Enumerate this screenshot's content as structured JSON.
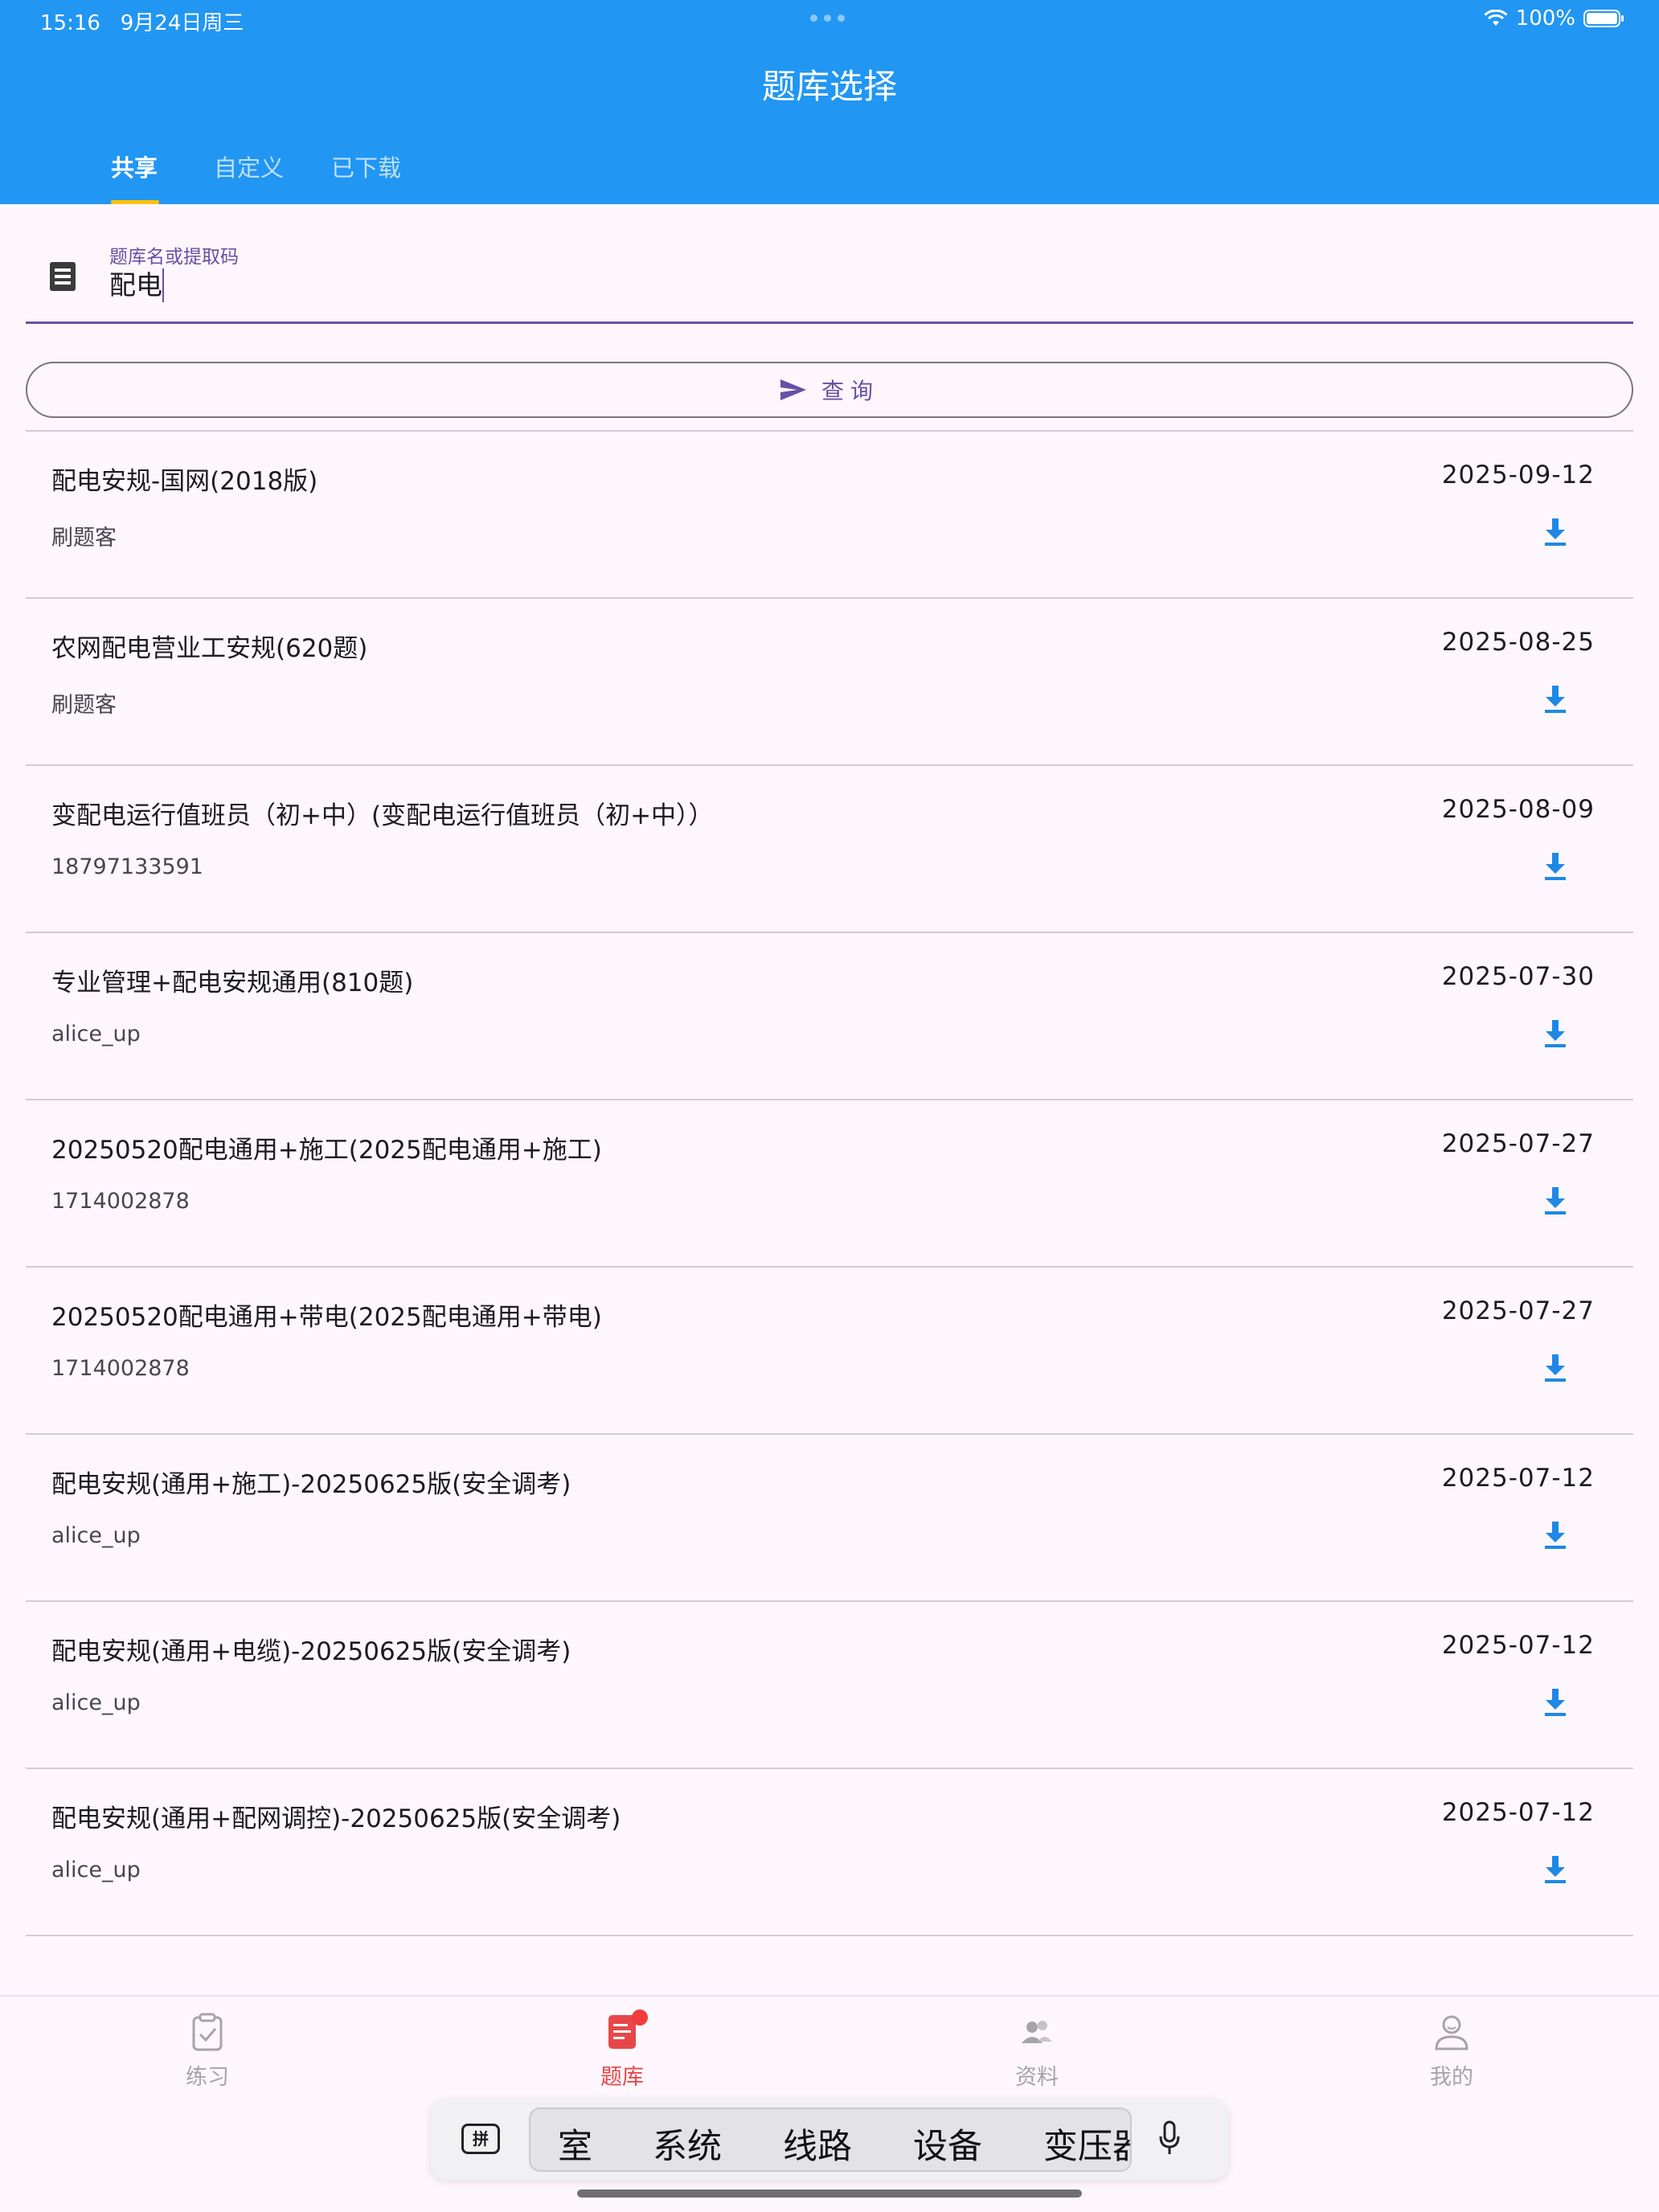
{
  "status_bar": {
    "time": "15:16",
    "date": "9月24日周三",
    "battery": "100%"
  },
  "header": {
    "title": "题库选择"
  },
  "tabs": [
    {
      "label": "共享",
      "active": true
    },
    {
      "label": "自定义",
      "active": false
    },
    {
      "label": "已下载",
      "active": false
    }
  ],
  "search": {
    "label": "题库名或提取码",
    "value": "配电",
    "icon": "list-icon"
  },
  "query_button": {
    "label": "查询",
    "icon": "send-icon"
  },
  "items": [
    {
      "title": "配电安规-国网(2018版)",
      "author": "刷题客",
      "date": "2025-09-12"
    },
    {
      "title": "农网配电营业工安规(620题)",
      "author": "刷题客",
      "date": "2025-08-25"
    },
    {
      "title": "变配电运行值班员（初+中）(变配电运行值班员（初+中））",
      "author": "18797133591",
      "date": "2025-08-09"
    },
    {
      "title": "专业管理+配电安规通用(810题)",
      "author": "alice_up",
      "date": "2025-07-30"
    },
    {
      "title": "20250520配电通用+施工(2025配电通用+施工)",
      "author": "1714002878",
      "date": "2025-07-27"
    },
    {
      "title": "20250520配电通用+带电(2025配电通用+带电)",
      "author": "1714002878",
      "date": "2025-07-27"
    },
    {
      "title": "配电安规(通用+施工)-20250625版(安全调考)",
      "author": "alice_up",
      "date": "2025-07-12"
    },
    {
      "title": "配电安规(通用+电缆)-20250625版(安全调考)",
      "author": "alice_up",
      "date": "2025-07-12"
    },
    {
      "title": "配电安规(通用+配网调控)-20250625版(安全调考)",
      "author": "alice_up",
      "date": "2025-07-12"
    }
  ],
  "bottom_nav": [
    {
      "label": "练习",
      "icon": "clipboard-check-icon",
      "active": false
    },
    {
      "label": "题库",
      "icon": "document-icon",
      "active": true
    },
    {
      "label": "资料",
      "icon": "people-icon",
      "active": false
    },
    {
      "label": "我的",
      "icon": "person-icon",
      "active": false
    }
  ],
  "ime": {
    "mode_label": "拼",
    "candidates": [
      "室",
      "系统",
      "线路",
      "设备",
      "变压器"
    ]
  },
  "colors": {
    "primary": "#2196f3",
    "accent": "#ffc107",
    "active_nav": "#e8474a",
    "purple": "#6750a4"
  }
}
